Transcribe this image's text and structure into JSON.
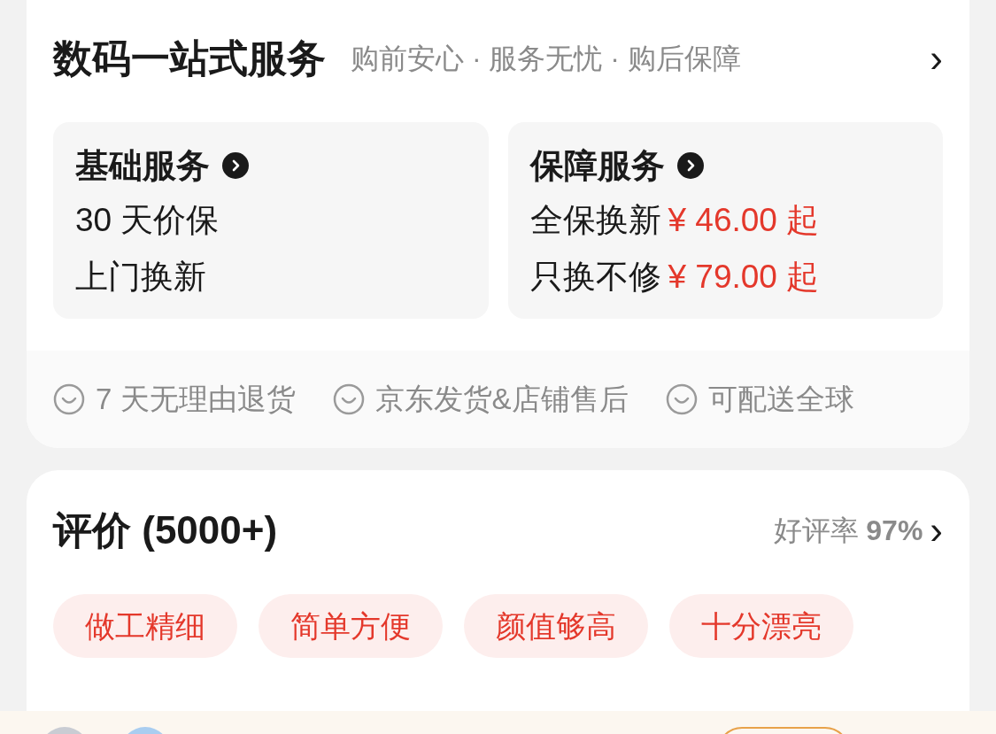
{
  "service_card": {
    "title": "数码一站式服务",
    "subtitle": "购前安心 · 服务无忧 · 购后保障",
    "chevron": "›",
    "panels": [
      {
        "title": "基础服务",
        "items": [
          {
            "label": "30 天价保"
          },
          {
            "label": "上门换新"
          }
        ]
      },
      {
        "title": "保障服务",
        "items": [
          {
            "label": "全保换新",
            "price": "¥ 46.00 起"
          },
          {
            "label": "只换不修",
            "price": "¥ 79.00 起"
          }
        ]
      }
    ],
    "promises": [
      "7 天无理由退货",
      "京东发货&店铺售后",
      "可配送全球"
    ]
  },
  "reviews": {
    "title": "评价 (5000+)",
    "rating_label": "好评率",
    "rating_value": "97%",
    "chevron": "›",
    "tags": [
      "做工精细",
      "简单方便",
      "颜值够高",
      "十分漂亮"
    ]
  }
}
